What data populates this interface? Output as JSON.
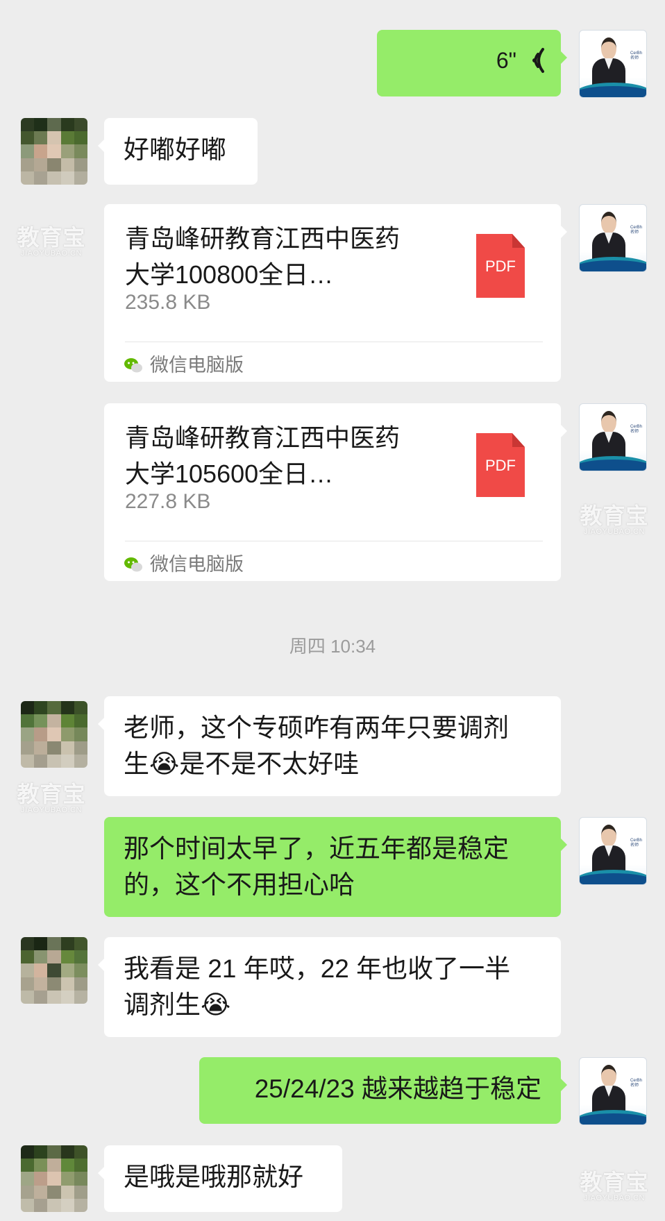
{
  "messages": {
    "voice": {
      "duration": "6\""
    },
    "m1": {
      "text": "好嘟好嘟"
    },
    "file1": {
      "name_line1": "青岛峰研教育江西中医药",
      "name_line2": "大学100800全日…",
      "size": "235.8 KB",
      "icon_label": "PDF",
      "source": "微信电脑版"
    },
    "file2": {
      "name_line1": "青岛峰研教育江西中医药",
      "name_line2": "大学105600全日…",
      "size": "227.8 KB",
      "icon_label": "PDF",
      "source": "微信电脑版"
    },
    "timestamp": "周四 10:34",
    "m2": {
      "line1": "老师，这个专硕咋有两年只要调剂",
      "line2": "生😭是不是不太好哇"
    },
    "m3": {
      "line1": "那个时间太早了，近五年都是稳定",
      "line2": "的，这个不用担心哈"
    },
    "m4": {
      "line1": "我看是 21 年哎，22 年也收了一半",
      "line2": "调剂生😭"
    },
    "m5": {
      "text": "25/24/23 越来越趋于稳定"
    },
    "m6": {
      "text": "是哦是哦那就好"
    }
  },
  "watermark": {
    "main": "教育宝",
    "sub": "JIAOYUBAO.CN"
  },
  "colors": {
    "background": "#ededed",
    "self_bubble": "#95ec69",
    "other_bubble": "#ffffff",
    "pdf_red": "#f04a47"
  },
  "icons": {
    "voice": "voice-wave-icon",
    "pdf": "pdf-file-icon",
    "wechat": "wechat-icon"
  }
}
